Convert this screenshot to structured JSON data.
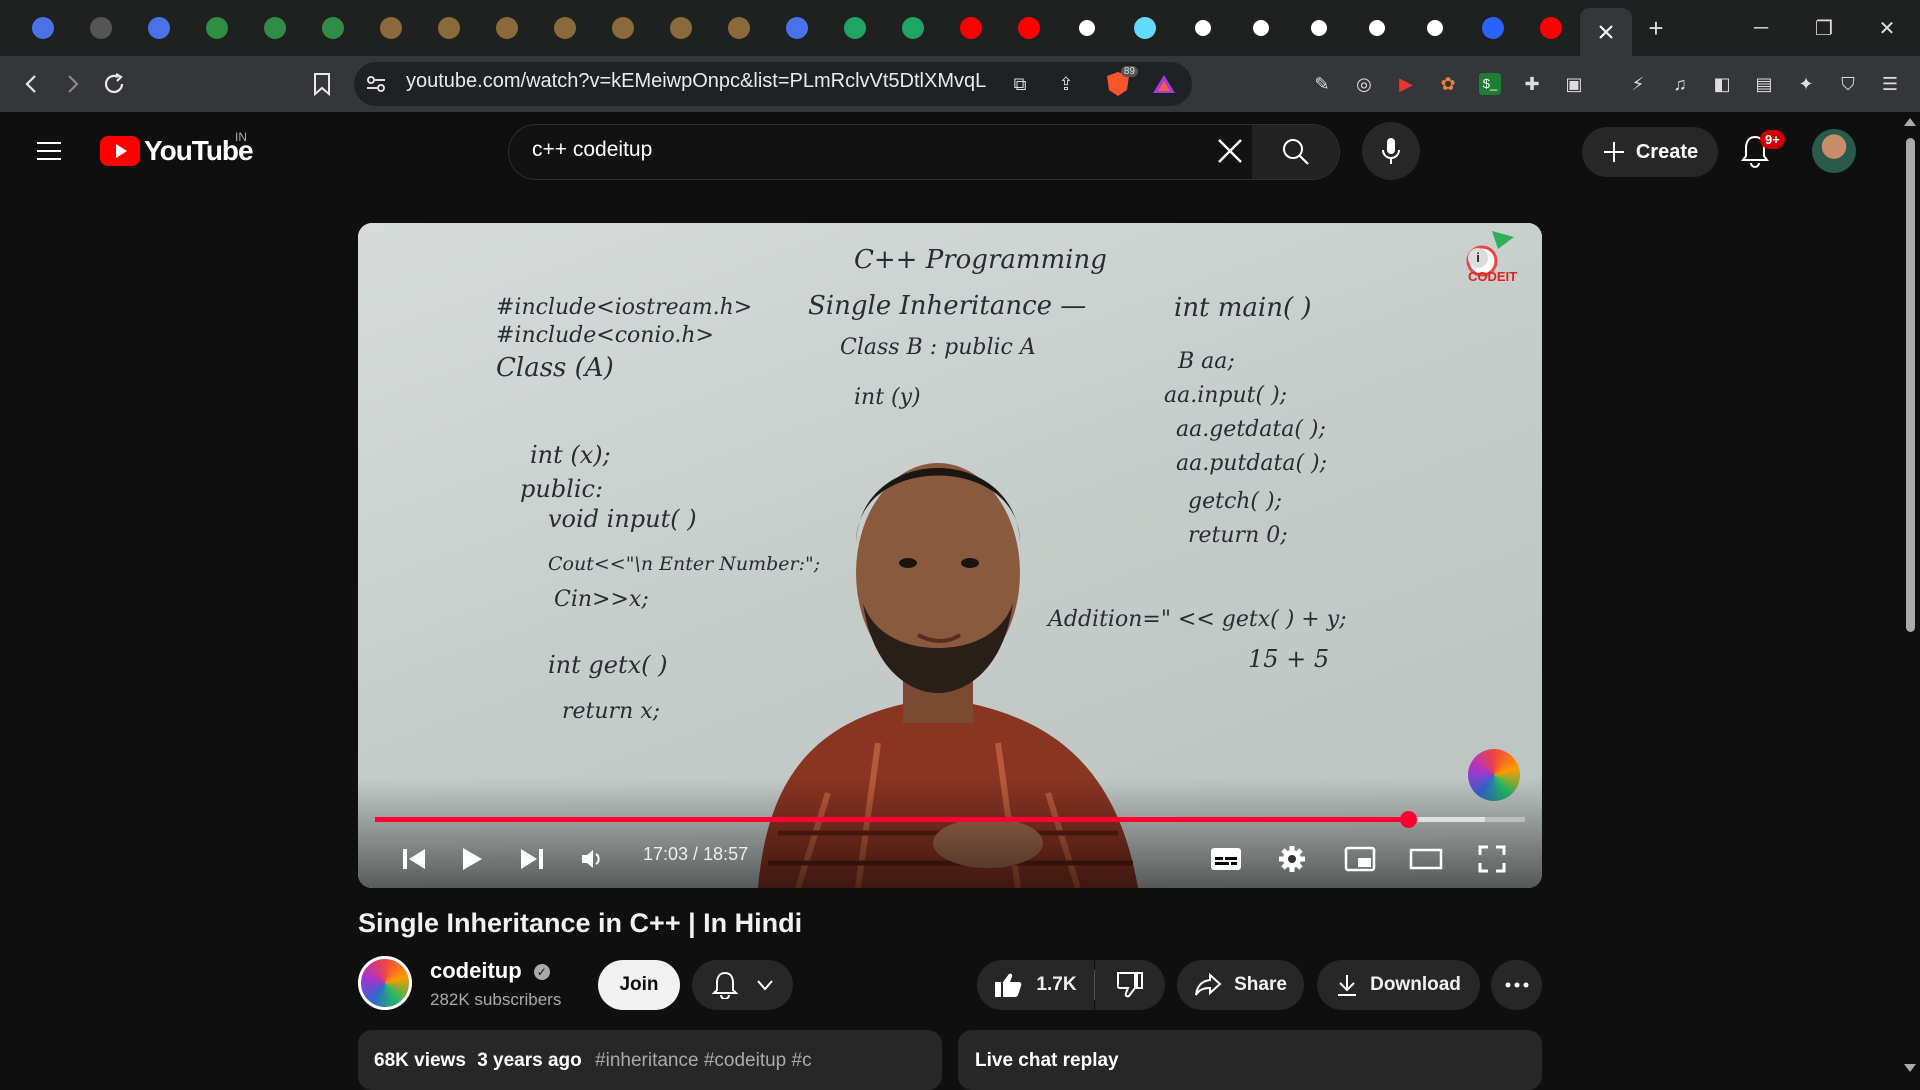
{
  "browser": {
    "tabs": [
      {
        "icon": "list-icon",
        "color": "#4a72e8"
      },
      {
        "icon": "bbc-icon",
        "color": "#555"
      },
      {
        "icon": "list-icon",
        "color": "#4a72e8"
      },
      {
        "icon": "gfg-icon",
        "color": "#2f8d46"
      },
      {
        "icon": "gfg-icon",
        "color": "#2f8d46"
      },
      {
        "icon": "gfg-icon",
        "color": "#2f8d46"
      },
      {
        "icon": "codechef-icon",
        "color": "#8a6a3a"
      },
      {
        "icon": "codechef-icon",
        "color": "#8a6a3a"
      },
      {
        "icon": "codechef-icon",
        "color": "#8a6a3a"
      },
      {
        "icon": "codechef-icon",
        "color": "#8a6a3a"
      },
      {
        "icon": "codechef-icon",
        "color": "#8a6a3a"
      },
      {
        "icon": "codechef-icon",
        "color": "#8a6a3a"
      },
      {
        "icon": "codechef-icon",
        "color": "#8a6a3a"
      },
      {
        "icon": "list-icon",
        "color": "#4a72e8"
      },
      {
        "icon": "drive-icon",
        "color": "#1fa463"
      },
      {
        "icon": "drive-icon",
        "color": "#1fa463"
      },
      {
        "icon": "youtube-icon",
        "color": "#ff0000"
      },
      {
        "icon": "youtube-icon",
        "color": "#ff0000"
      },
      {
        "icon": "github-icon",
        "color": "#ffffff"
      },
      {
        "icon": "react-icon",
        "color": "#61dafb"
      },
      {
        "icon": "codeium-icon",
        "color": "#ffffff"
      },
      {
        "icon": "github-icon",
        "color": "#ffffff"
      },
      {
        "icon": "github-icon",
        "color": "#ffffff"
      },
      {
        "icon": "github-icon",
        "color": "#ffffff"
      },
      {
        "icon": "openai-icon",
        "color": "#ffffff"
      },
      {
        "icon": "hashnode-icon",
        "color": "#2962ff"
      },
      {
        "icon": "youtube-icon",
        "color": "#ff0000"
      }
    ],
    "url": "youtube.com/watch?v=kEMeiwpOnpc&list=PLmRclvVt5DtlXMvqL...",
    "shields_count": "89"
  },
  "youtube": {
    "logo_text": "YouTube",
    "region": "IN",
    "search_value": "c++ codeitup",
    "create_label": "Create",
    "notifications_badge": "9+"
  },
  "player": {
    "time_display": "17:03 / 18:57",
    "played_fraction": 0.898,
    "buffered_fraction": 0.965,
    "board_lines": [
      "C++ Programming",
      "#include<iostream.h>",
      "#include<conio.h>",
      "Class (A)",
      "int (x);",
      "public:",
      "void input( )",
      "Cout<<\"\\n Enter Number:\";",
      "Cin>>x;",
      "int getx( )",
      "return x;",
      "Single Inheritance —",
      "Class B : public A",
      "int (y)",
      "int main( )",
      "B aa;",
      "aa.input( );",
      "aa.getdata( );",
      "aa.putdata( );",
      "getch( );",
      "return 0;",
      "Addition=\" << getx( ) + y;",
      "15 + 5"
    ]
  },
  "video": {
    "title": "Single Inheritance in C++ | In Hindi",
    "channel_name": "codeitup",
    "subscribers": "282K subscribers",
    "join_label": "Join",
    "likes": "1.7K",
    "share_label": "Share",
    "download_label": "Download",
    "views": "68K views",
    "age": "3 years ago",
    "hashtags": "#inheritance #codeitup #c",
    "live_chat_label": "Live chat replay"
  }
}
